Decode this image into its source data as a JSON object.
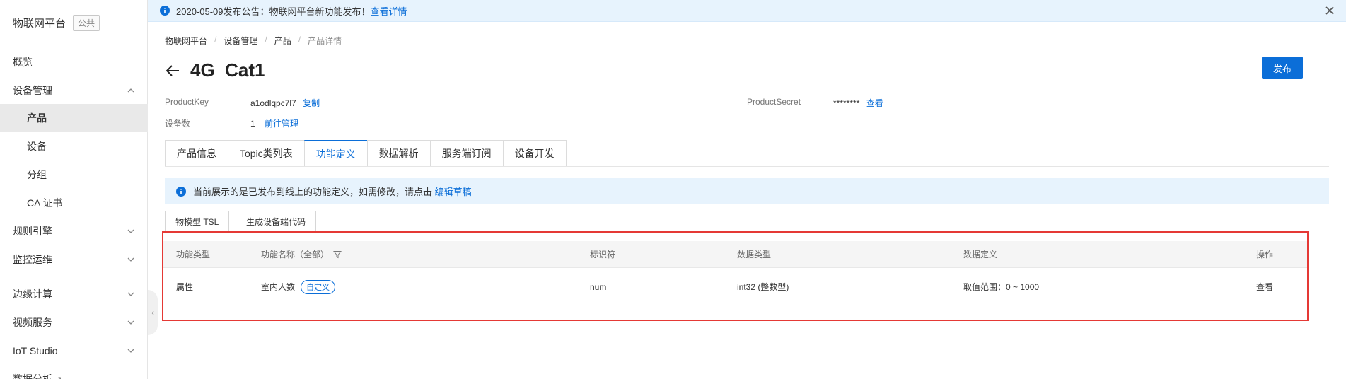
{
  "brand": {
    "title": "物联网平台",
    "badge": "公共"
  },
  "sidebar": {
    "items": [
      {
        "label": "概览"
      },
      {
        "label": "设备管理"
      },
      {
        "label": "产品"
      },
      {
        "label": "设备"
      },
      {
        "label": "分组"
      },
      {
        "label": "CA 证书"
      },
      {
        "label": "规则引擎"
      },
      {
        "label": "监控运维"
      },
      {
        "label": "边缘计算"
      },
      {
        "label": "视频服务"
      },
      {
        "label": "IoT Studio"
      },
      {
        "label": "数据分析"
      }
    ]
  },
  "notice": {
    "text": "2020-05-09发布公告：物联网平台新功能发布！",
    "link": "查看详情"
  },
  "breadcrumb": [
    "物联网平台",
    "设备管理",
    "产品",
    "产品详情"
  ],
  "page": {
    "title": "4G_Cat1",
    "publish_label": "发布"
  },
  "meta": {
    "product_key_label": "ProductKey",
    "product_key_value": "a1odlqpc7l7",
    "copy_label": "复制",
    "device_count_label": "设备数",
    "device_count_value": "1",
    "goto_manage_label": "前往管理",
    "product_secret_label": "ProductSecret",
    "product_secret_value": "********",
    "view_label": "查看"
  },
  "tabs": [
    {
      "label": "产品信息"
    },
    {
      "label": "Topic类列表"
    },
    {
      "label": "功能定义"
    },
    {
      "label": "数据解析"
    },
    {
      "label": "服务端订阅"
    },
    {
      "label": "设备开发"
    }
  ],
  "info_banner": {
    "text": "当前展示的是已发布到线上的功能定义，如需修改，请点击",
    "link": "编辑草稿"
  },
  "buttons": {
    "tsl": "物模型 TSL",
    "gen_code": "生成设备端代码"
  },
  "table": {
    "headers": [
      "功能类型",
      "功能名称（全部）",
      "标识符",
      "数据类型",
      "数据定义",
      "操作"
    ],
    "rows": [
      {
        "type": "属性",
        "name": "室内人数",
        "tag": "自定义",
        "identifier": "num",
        "data_type": "int32 (整数型)",
        "definition": "取值范围：0 ~ 1000",
        "action": "查看"
      }
    ]
  },
  "colors": {
    "accent": "#0b6ed8",
    "highlight_border": "#e53935",
    "notice_bg": "#e7f3fd"
  }
}
